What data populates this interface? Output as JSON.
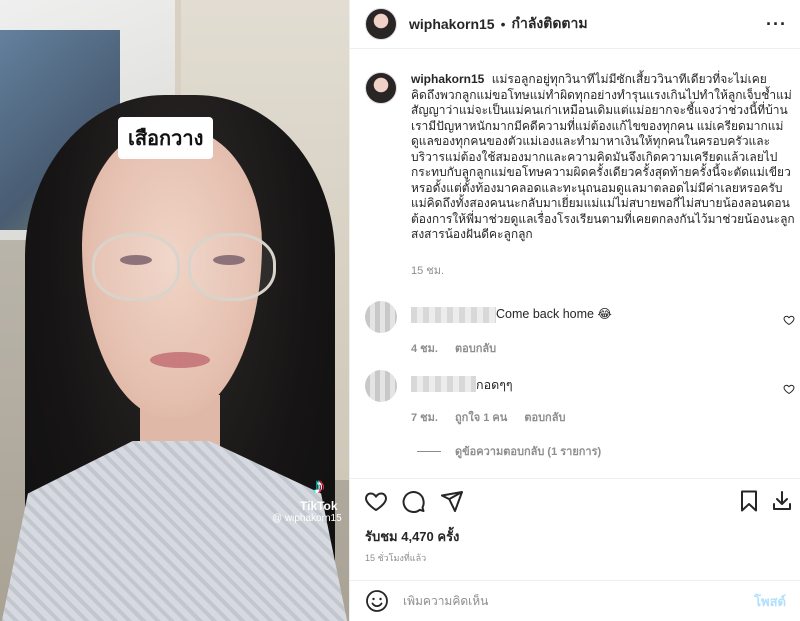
{
  "media": {
    "overlay_caption": "เสือกวาง",
    "tiktok_logo": "♪",
    "tiktok_word": "TikTok",
    "tiktok_handle": "@ wiphakorn15"
  },
  "header": {
    "username": "wiphakorn15",
    "separator": "•",
    "follow_status": "กำลังติดตาม",
    "more_icon": "more-icon"
  },
  "caption": {
    "username": "wiphakorn15",
    "text": "แม่รอลูกอยู่ทุกวินาทีไม่มีซักเสี้ยววินาทีเดียวที่จะไม่เคยคิดถึงพวกลูกแม่ขอโทษแม่ทำผิดทุกอย่างทำรุนแรงเกินไปทำให้ลูกเจ็บช้ำแม่สัญญาว่าแม่จะเป็นแม่คนเก่าเหมือนเดิมแต่แม่อยากจะชี้แจงว่าช่วงนี้ที่บ้านเรามีปัญหาหนักมากมีคดีความที่แม่ต้องแก้ไขของทุกคน แม่เครียดมากแม่ดูแลของทุกคนของตัวแม่เองและทำมาหาเงินให้ทุกคนในครอบครัวและบริวารแม่ต้องใช้สมองมากและความคิดมันจึงเกิดความเครียดแล้วเลยไปกระทบกับลูกลูกแม่ขอโทษความผิดครั้งเดียวครั้งสุดท้ายครั้งนี้จะตัดแม่เขียวหรอดั้งแต่ตั้งท้องมาคลอดและทะนุถนอมดูแลมาตลอดไม่มีค่าเลยหรอครับแม่คิดถึงทั้งสองคนนะกลับมาเยี่ยมแม่แม่ไม่สบายพอกี่ไม่สบายน้องลอนดอนต้องการให้พี่มาช่วยดูแลเรื่องโรงเรียนตามที่เคยตกลงกันไว้มาช่วยน้องนะลูกสงสารน้องฝันดีคะลูกลูก",
    "time": "15 ชม."
  },
  "comments": [
    {
      "text": "Come back home 😂",
      "time": "4 ชม.",
      "likes": "",
      "reply_label": "ตอบกลับ"
    },
    {
      "text": "กอดๆๆ",
      "time": "7 ชม.",
      "likes": "ถูกใจ 1 คน",
      "reply_label": "ตอบกลับ"
    }
  ],
  "replies_toggle": "ดูข้อความตอบกลับ (1 รายการ)",
  "actions": {
    "like_icon": "heart-icon",
    "comment_icon": "comment-icon",
    "share_icon": "share-icon",
    "save_icon": "bookmark-icon",
    "download_icon": "download-icon"
  },
  "stats": {
    "views": "รับชม 4,470 ครั้ง",
    "posted": "15 ชั่วโมงที่แล้ว"
  },
  "add_comment": {
    "placeholder": "เพิ่มความคิดเห็น",
    "post_label": "โพสต์",
    "emoji_icon": "emoji-icon"
  }
}
